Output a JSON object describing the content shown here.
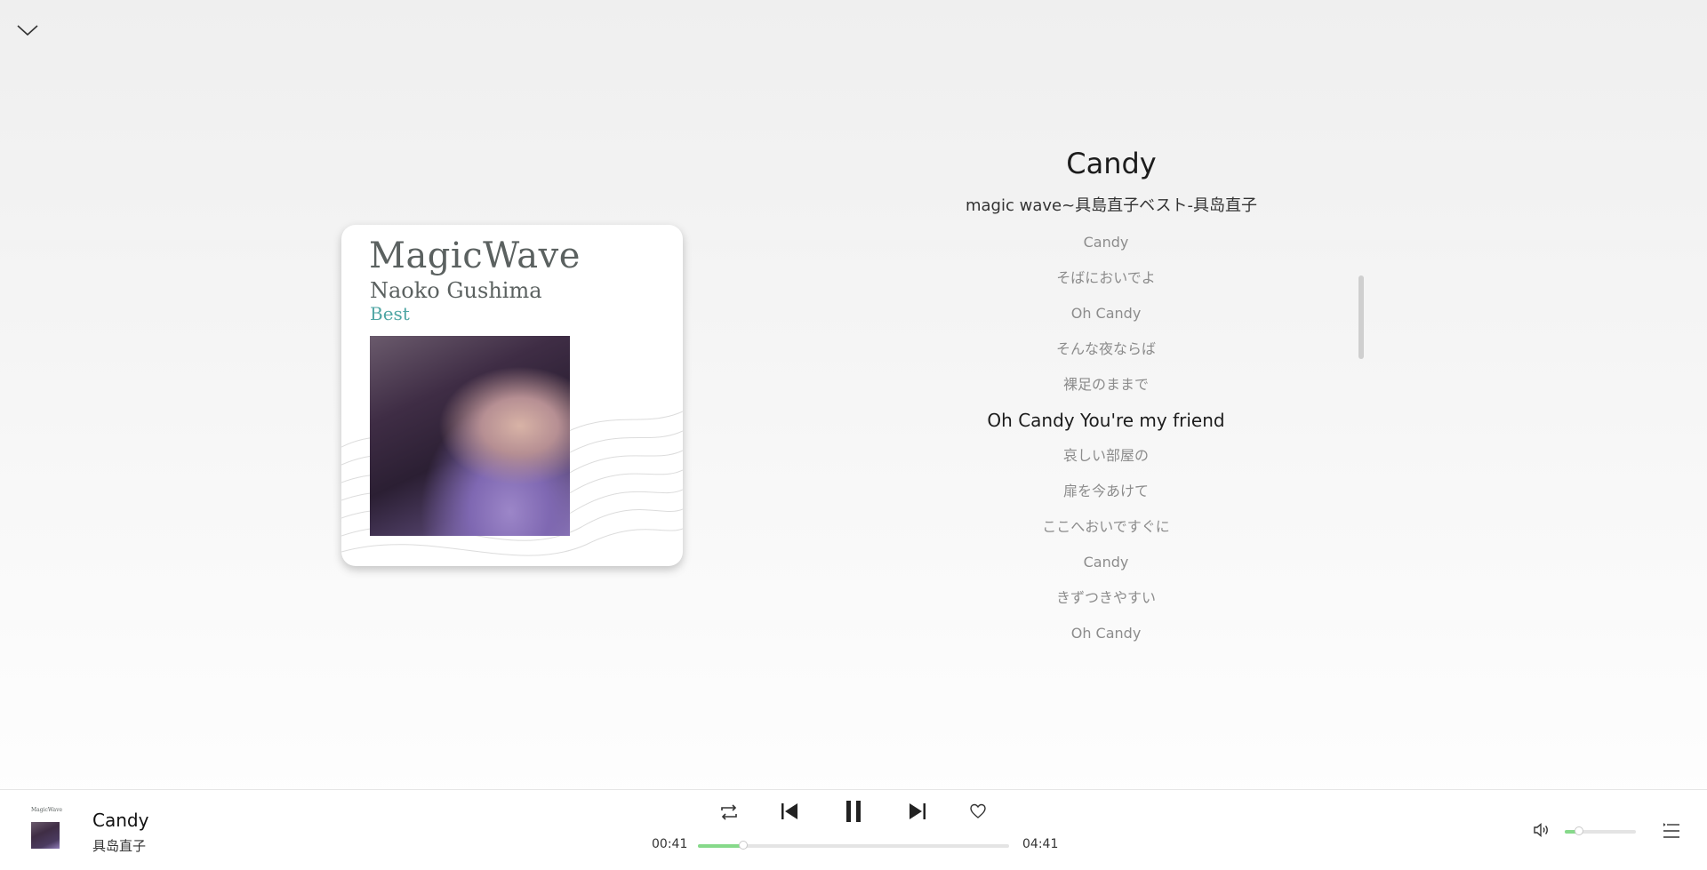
{
  "header": {
    "collapse_icon": "chevron-down-icon"
  },
  "album_cover": {
    "title_art": "MagicWave",
    "artist_art": "Naoko Gushima",
    "edition_art": "Best"
  },
  "song": {
    "title": "Candy",
    "subtitle": "magic wave~具島直子ベスト-具岛直子"
  },
  "lyrics": [
    "Candy",
    "そばにおいでよ",
    "Oh Candy",
    "そんな夜ならば",
    "裸足のままで",
    "Oh Candy You're my friend",
    "哀しい部屋の",
    "扉を今あけて",
    "ここへおいですぐに",
    "Candy",
    "きずつきやすい",
    "Oh Candy"
  ],
  "active_lyric_index": 5,
  "player": {
    "title": "Candy",
    "artist": "具岛直子",
    "current_time": "00:41",
    "total_time": "04:41",
    "progress": 0.146,
    "volume": 0.2,
    "icons": {
      "repeat": "repeat-icon",
      "previous": "previous-track-icon",
      "pause": "pause-icon",
      "next": "next-track-icon",
      "like": "heart-icon",
      "volume": "volume-icon",
      "playlist": "playlist-icon"
    }
  },
  "colors": {
    "accent": "#86d98a",
    "active_lyric": "#1c1c1c",
    "inactive_lyric": "#8c8c8c"
  }
}
